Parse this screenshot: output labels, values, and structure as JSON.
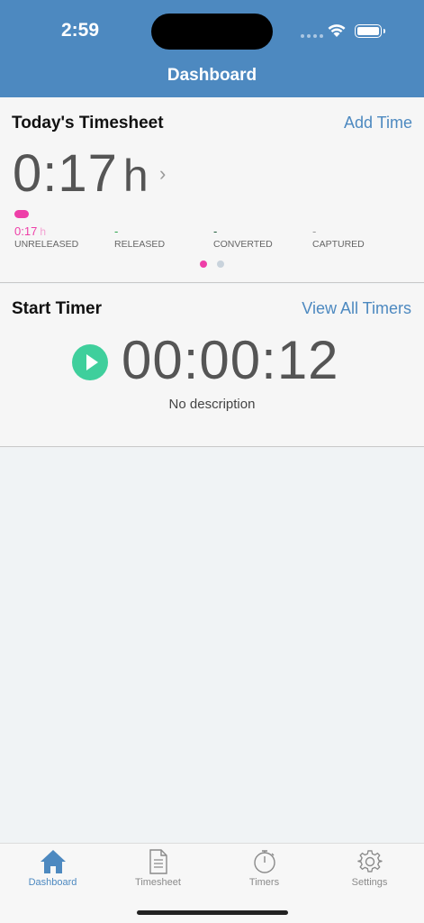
{
  "status_bar": {
    "time": "2:59"
  },
  "nav": {
    "title": "Dashboard"
  },
  "timesheet": {
    "title": "Today's Timesheet",
    "add_time_label": "Add Time",
    "total_value": "0:17",
    "total_unit": "h",
    "stats": [
      {
        "value": "0:17",
        "unit": "h",
        "label": "UNRELEASED",
        "color": "#ee3fa8"
      },
      {
        "value": "-",
        "unit": "",
        "label": "RELEASED",
        "color": "#2aa44a"
      },
      {
        "value": "-",
        "unit": "",
        "label": "CONVERTED",
        "color": "#1f5c3a"
      },
      {
        "value": "-",
        "unit": "",
        "label": "CAPTURED",
        "color": "#999999"
      }
    ],
    "page_count": 2,
    "current_page": 1
  },
  "timer": {
    "title": "Start Timer",
    "view_all_label": "View All Timers",
    "elapsed": "00:00:12",
    "description": "No description"
  },
  "tabs": [
    {
      "label": "Dashboard",
      "icon": "home-icon",
      "active": true
    },
    {
      "label": "Timesheet",
      "icon": "document-icon",
      "active": false
    },
    {
      "label": "Timers",
      "icon": "stopwatch-icon",
      "active": false
    },
    {
      "label": "Settings",
      "icon": "gear-icon",
      "active": false
    }
  ],
  "colors": {
    "brand": "#4d89c0",
    "play": "#3fcf9c",
    "unreleased": "#ee3fa8"
  }
}
